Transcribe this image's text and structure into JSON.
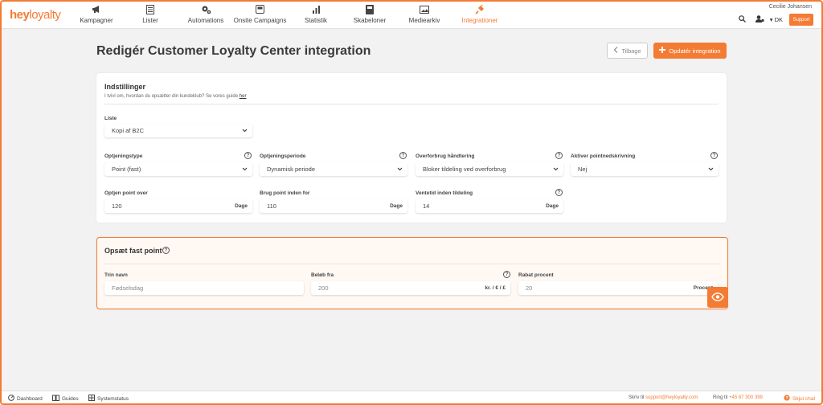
{
  "brand": {
    "logo_part1": "hey",
    "logo_part2": "loyalty",
    "accent_color": "#f47b34"
  },
  "nav": {
    "items": [
      {
        "label": "Kampagner",
        "icon": "megaphone-icon"
      },
      {
        "label": "Lister",
        "icon": "list-icon"
      },
      {
        "label": "Automations",
        "icon": "gears-icon"
      },
      {
        "label": "Onsite Campaigns",
        "icon": "window-icon"
      },
      {
        "label": "Statistik",
        "icon": "bar-chart-icon"
      },
      {
        "label": "Skabeloner",
        "icon": "template-icon"
      },
      {
        "label": "Mediearkiv",
        "icon": "image-icon"
      },
      {
        "label": "Integrationer",
        "icon": "plug-icon"
      }
    ],
    "active": "Integrationer",
    "user_name": "Cecilie Johansen",
    "language": "DK",
    "support_label": "Support"
  },
  "page": {
    "title": "Redigér Customer Loyalty Center integration",
    "back_label": "Tilbage",
    "update_label": "Opdatér integration"
  },
  "settings": {
    "title": "Indstillinger",
    "subtitle": "I tvivl om, hvordan du opsætter din kundeklub? Se vores guide",
    "subtitle_link": "her",
    "liste_label": "Liste",
    "liste_value": "Kopi af B2C",
    "optjeningstype_label": "Optjeningstype",
    "optjeningstype_value": "Point (fast)",
    "optjeningsperiode_label": "Optjeningsperiode",
    "optjeningsperiode_value": "Dynamisk periode",
    "overforbrug_label": "Overforbrug håndtering",
    "overforbrug_value": "Bloker tildeling ved overforbrug",
    "pointnedskrivning_label": "Aktiver pointnedskrivning",
    "pointnedskrivning_value": "Nej",
    "optjen_over_label": "Optjen point over",
    "optjen_over_value": "120",
    "optjen_over_suffix": "Dage",
    "brug_inden_label": "Brug point inden for",
    "brug_inden_value": "110",
    "brug_inden_suffix": "Dage",
    "ventetid_label": "Ventetid inden tildeling",
    "ventetid_value": "14",
    "ventetid_suffix": "Dage"
  },
  "fast_point": {
    "title": "Opsæt fast point",
    "trin_label": "Trin navn",
    "trin_value": "Fødselsdag",
    "beloeb_label": "Beløb fra",
    "beloeb_value": "200",
    "beloeb_suffix": "kr. / € / £",
    "rabat_label": "Rabat procent",
    "rabat_value": "20",
    "rabat_suffix": "Procent"
  },
  "footer": {
    "dashboard": "Dashboard",
    "guides": "Guides",
    "systemstatus": "Systemstatus",
    "write_prefix": "Skriv til",
    "email": "support@heyloyalty.com",
    "call_prefix": "Ring til",
    "phone": "+45 87 300 399",
    "hide_chat": "Skjul chat"
  }
}
